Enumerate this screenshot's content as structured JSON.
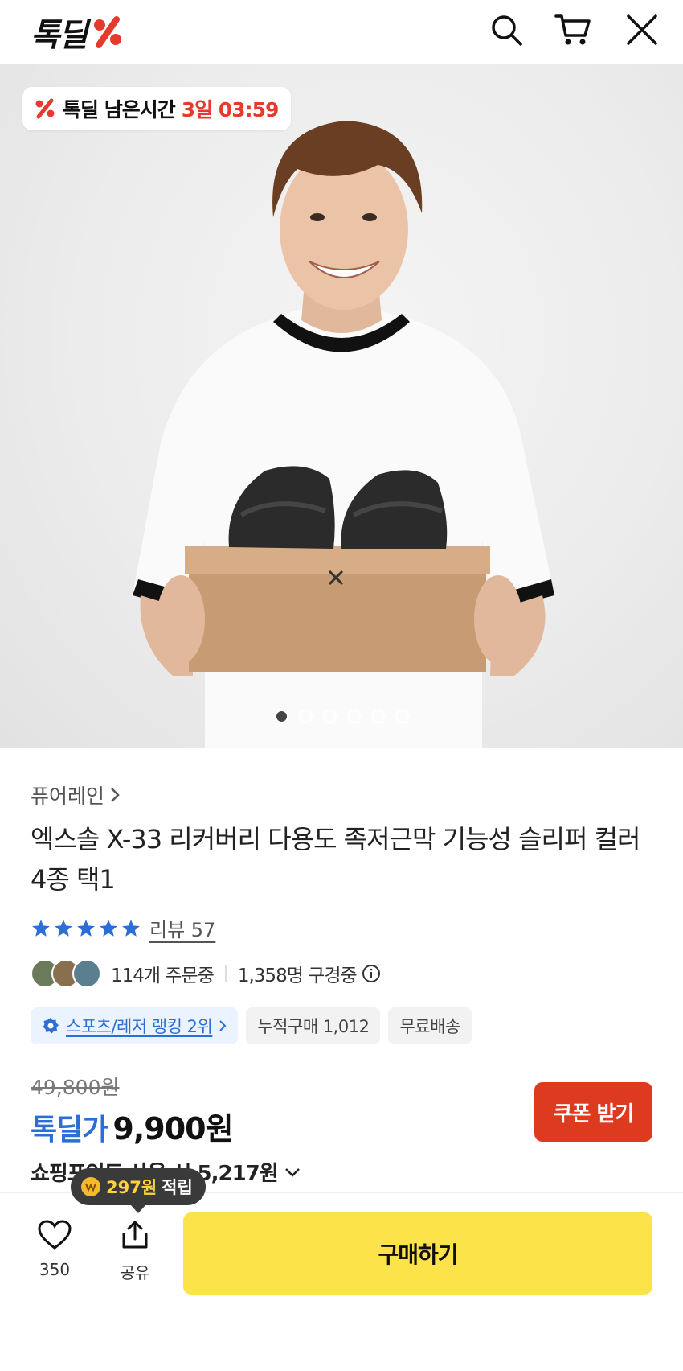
{
  "header": {
    "logo_text": "톡딜",
    "brand_color": "#e63a2e",
    "icons": [
      "search-icon",
      "cart-icon",
      "close-icon"
    ]
  },
  "hero": {
    "timer_label": "톡딜 남은시간",
    "timer_value": "3일 03:59",
    "slide_count": 6,
    "active_slide": 1
  },
  "product": {
    "brand": "퓨어레인",
    "title": "엑스솔 X-33 리커버리 다용도 족저근막 기능성 슬리퍼 컬러 4종 택1",
    "rating_stars": 5,
    "review_label": "리뷰 57",
    "orders_text": "114개 주문중",
    "viewers_text": "1,358명 구경중",
    "rank_chip": "스포츠/레저 랭킹 2위",
    "cumulative_chip": "누적구매 1,012",
    "shipping_chip": "무료배송",
    "original_price": "49,800원",
    "deal_label": "톡딜가",
    "deal_price": "9,900원",
    "coupon_button": "쿠폰 받기",
    "points_text": "쇼핑포인트 사용 시 5,217원"
  },
  "bottom": {
    "tooltip_amount": "297원",
    "tooltip_label": "적립",
    "like_count": "350",
    "share_label": "공유",
    "buy_button": "구매하기"
  },
  "colors": {
    "accent_blue": "#2b6fd6",
    "coupon_red": "#dd3a1f",
    "buy_yellow": "#fde34a",
    "star_blue": "#2b6fd6"
  }
}
